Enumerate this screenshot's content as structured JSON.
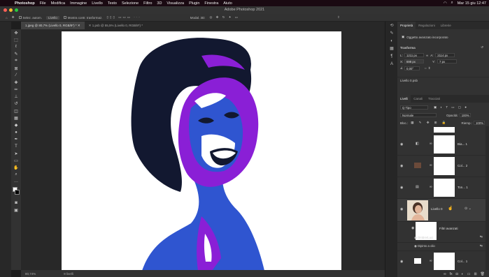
{
  "menubar": {
    "app": "Photoshop",
    "items": [
      "File",
      "Modifica",
      "Immagine",
      "Livello",
      "Testo",
      "Selezione",
      "Filtro",
      "3D",
      "Visualizza",
      "Plugin",
      "Finestra",
      "Aiuto"
    ],
    "clock": "Mar 15 giu  12:47"
  },
  "window": {
    "title": "Adobe Photoshop 2021"
  },
  "options": {
    "autoselect": "Selez. autom.",
    "target": "Livello",
    "transform": "Mostra contr. trasformaz."
  },
  "doc_tabs": [
    {
      "label": "1.jpeg @ 80,7% (Livello 0, RGB/8*) *"
    },
    {
      "label": "1.psb @ 55,5% (Livello 0, RGB/8*) *"
    }
  ],
  "status": {
    "zoom": "80,74%",
    "info": "8 livelli"
  },
  "properties": {
    "tabs": [
      "Proprietà",
      "Regolazioni",
      "Librerie"
    ],
    "object_type": "Oggetto avanzato incorporato",
    "section": "Trasforma",
    "w_label": "L:",
    "w_value": "1211 px",
    "h_label": "A:",
    "h_value": "2114 px",
    "x_label": "X:",
    "x_value": "698 px",
    "y_label": "Y:",
    "y_value": "7 px",
    "angle": "0,00°",
    "file": "Livello 0.psb"
  },
  "layers_panel": {
    "tabs": [
      "Livelli",
      "Canali",
      "Tracciati"
    ],
    "filter": "Q Tipo",
    "blend": "Normale",
    "opacity_label": "Opacità:",
    "opacity": "100%",
    "lock_label": "Bloc.:",
    "fill_label": "Riemp.:",
    "fill": "100%",
    "layers": [
      {
        "name": "Bia... 1"
      },
      {
        "name": "Col... 2"
      },
      {
        "name": "Ton... 1"
      },
      {
        "name": "Livello 0"
      },
      {
        "name": "Filtri avanzati"
      },
      {
        "name": "Ombre/Luci"
      },
      {
        "name": "Dipinto a olio"
      },
      {
        "name": "Col... 1"
      }
    ]
  },
  "colors": {
    "accent": "#3a6fd8",
    "purple": "#8a1fd6",
    "blue": "#2f55d0",
    "dark": "#121830"
  }
}
